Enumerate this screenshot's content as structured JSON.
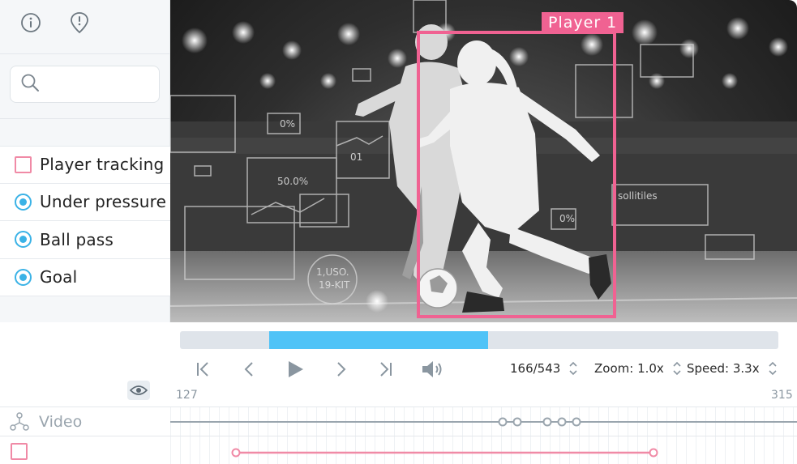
{
  "sidebar": {
    "icons": [
      "info-icon",
      "flag-alert-icon"
    ],
    "search": {
      "placeholder": "",
      "value": ""
    },
    "labels": [
      {
        "text": "Player tracking",
        "kind": "checkbox",
        "color": "#f08aa6"
      },
      {
        "text": "Under pressure",
        "kind": "radio",
        "color": "#3ab2e6"
      },
      {
        "text": "Ball pass",
        "kind": "radio",
        "color": "#3ab2e6"
      },
      {
        "text": "Goal",
        "kind": "radio",
        "color": "#3ab2e6"
      }
    ]
  },
  "viewer": {
    "bbox_label": "Player 1",
    "bbox_color": "#f06292"
  },
  "controls": {
    "frame": "166/543",
    "zoom": "Zoom: 1.0x",
    "speed": "Speed: 3.3x",
    "range_start": "127",
    "range_end": "315",
    "progress_color": "#4fc3f7"
  },
  "timeline": {
    "tracks": [
      {
        "label": "Video",
        "icon": "video-track-icon"
      },
      {
        "label": "",
        "icon": "checkbox-track-icon"
      }
    ]
  }
}
